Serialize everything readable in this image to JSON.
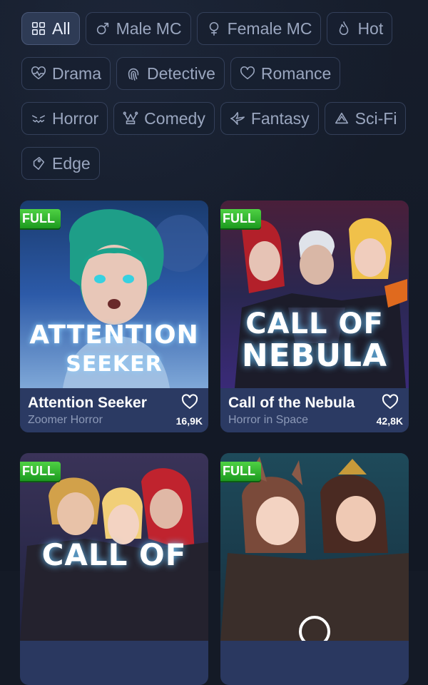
{
  "genres": [
    {
      "label": "All",
      "icon": "grid-icon",
      "active": true
    },
    {
      "label": "Male MC",
      "icon": "male-icon"
    },
    {
      "label": "Female MC",
      "icon": "female-icon"
    },
    {
      "label": "Hot",
      "icon": "flame-icon"
    },
    {
      "label": "Drama",
      "icon": "heartbeat-icon"
    },
    {
      "label": "Detective",
      "icon": "fingerprint-icon"
    },
    {
      "label": "Romance",
      "icon": "heart-icon"
    },
    {
      "label": "Horror",
      "icon": "evil-face-icon"
    },
    {
      "label": "Comedy",
      "icon": "jester-hat-icon"
    },
    {
      "label": "Fantasy",
      "icon": "bird-icon"
    },
    {
      "label": "Sci-Fi",
      "icon": "triangle-icon"
    },
    {
      "label": "Edge",
      "icon": "tag-icon"
    }
  ],
  "badge_label": "FULL",
  "cards": [
    {
      "title": "Attention Seeker",
      "subtitle": "Zoomer Horror",
      "likes": "16,9K",
      "cover_line1": "ATTENTION",
      "cover_line2": "SEEKER"
    },
    {
      "title": "Call of the Nebula",
      "subtitle": "Horror in Space",
      "likes": "42,8K",
      "cover_line1": "CALL OF",
      "cover_line2": "NEBULA"
    },
    {
      "title": "",
      "subtitle": "",
      "likes": "",
      "cover_line1": "CALL OF",
      "cover_line2": ""
    },
    {
      "title": "",
      "subtitle": "",
      "likes": "",
      "cover_line1": "",
      "cover_line2": ""
    }
  ],
  "colors": {
    "background": "#141a26",
    "chip_border": "#34405a",
    "card_info": "#2b3a63",
    "badge_green": "#2bb22c"
  }
}
